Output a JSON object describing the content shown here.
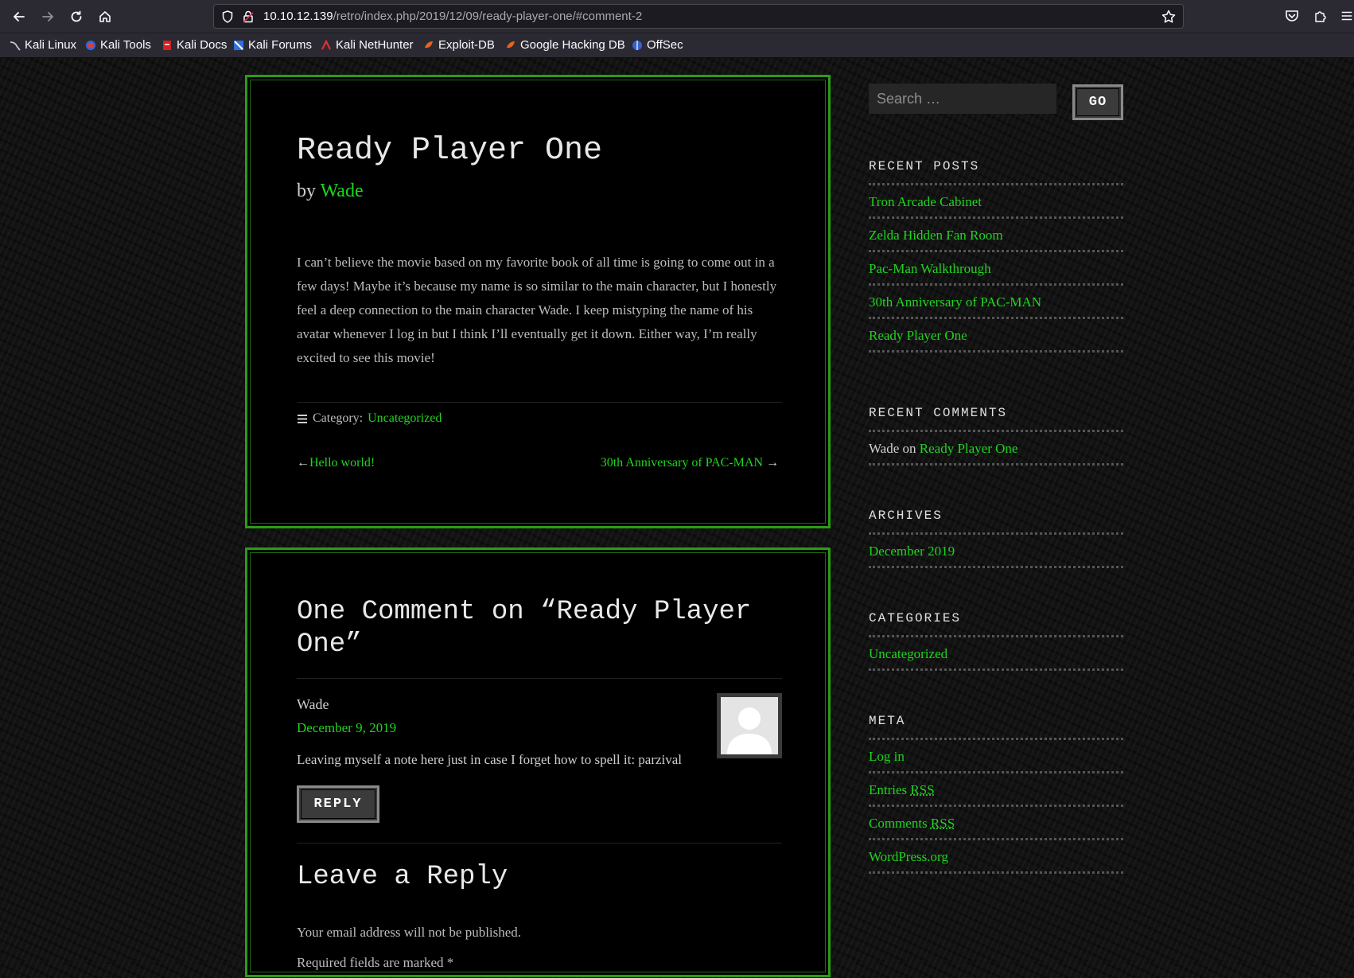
{
  "browser": {
    "url_host": "10.10.12.139",
    "url_path": "/retro/index.php/2019/12/09/ready-player-one/#comment-2",
    "bookmarks": [
      {
        "label": "Kali Linux",
        "icon": "kali-dragon-icon"
      },
      {
        "label": "Kali Tools",
        "icon": "kali-tools-icon"
      },
      {
        "label": "Kali Docs",
        "icon": "kali-docs-icon"
      },
      {
        "label": "Kali Forums",
        "icon": "kali-forums-icon"
      },
      {
        "label": "Kali NetHunter",
        "icon": "nethunter-icon"
      },
      {
        "label": "Exploit-DB",
        "icon": "exploit-db-icon"
      },
      {
        "label": "Google Hacking DB",
        "icon": "ghdb-icon"
      },
      {
        "label": "OffSec",
        "icon": "offsec-icon"
      }
    ]
  },
  "post": {
    "title": "Ready Player One",
    "by": "by",
    "author": "Wade",
    "body": "I can’t believe the movie based on my favorite book of all time is going to come out in a few days! Maybe it’s because my name is so similar to the main character, but I honestly feel a deep connection to the main character Wade. I keep mistyping the name of his avatar whenever I log in but I think I’ll eventually get it down. Either way, I’m really excited to see this movie!",
    "category_label": "Category:",
    "category": "Uncategorized",
    "prev_post": "Hello world!",
    "next_post": "30th Anniversary of PAC-MAN"
  },
  "comments": {
    "title": "One Comment on “Ready Player One”",
    "items": [
      {
        "author": "Wade",
        "date": "December 9, 2019",
        "text": "Leaving myself a note here just in case I forget how to spell it: parzival",
        "reply_label": "REPLY"
      }
    ],
    "leave_reply_title": "Leave a Reply",
    "email_note": "Your email address will not be published.",
    "required_note": "Required fields are marked *"
  },
  "sidebar": {
    "search_placeholder": "Search …",
    "go_label": "GO",
    "recent_posts": {
      "title": "RECENT POSTS",
      "items": [
        "Tron Arcade Cabinet",
        "Zelda Hidden Fan Room",
        "Pac-Man Walkthrough",
        "30th Anniversary of PAC-MAN",
        "Ready Player One"
      ]
    },
    "recent_comments": {
      "title": "RECENT COMMENTS",
      "items": [
        {
          "author": "Wade",
          "on": "on",
          "post": "Ready Player One"
        }
      ]
    },
    "archives": {
      "title": "ARCHIVES",
      "items": [
        "December 2019"
      ]
    },
    "categories": {
      "title": "CATEGORIES",
      "items": [
        "Uncategorized"
      ]
    },
    "meta": {
      "title": "META",
      "items": [
        {
          "text": "Log in",
          "abbr": ""
        },
        {
          "text": "Entries ",
          "abbr": "RSS"
        },
        {
          "text": "Comments ",
          "abbr": "RSS"
        },
        {
          "text": "WordPress.org",
          "abbr": ""
        }
      ]
    }
  },
  "colors": {
    "accent_green": "#1fd51f",
    "card_border": "#2a9d14",
    "background": "#121212"
  }
}
